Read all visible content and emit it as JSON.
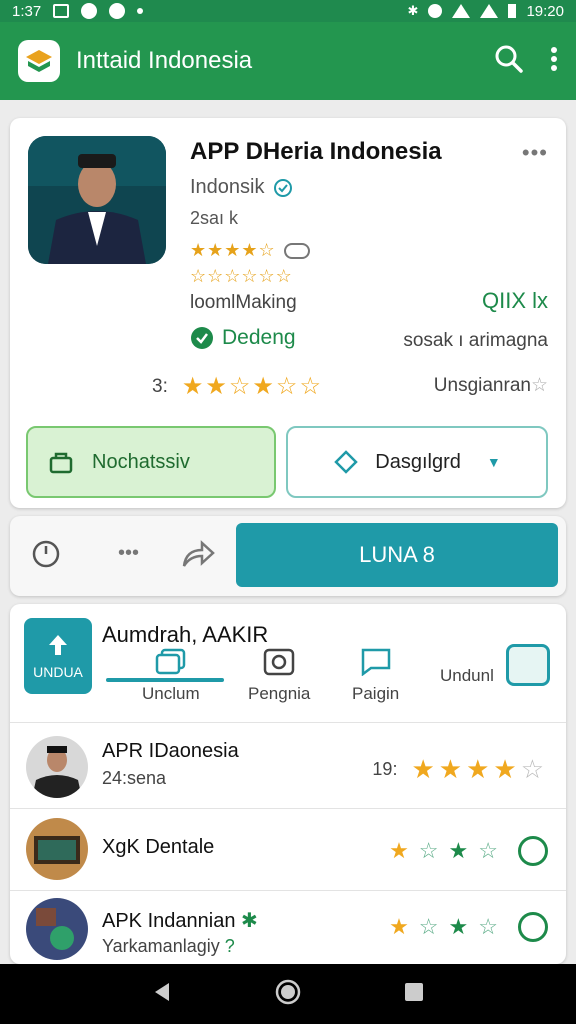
{
  "status_bar": {
    "time_left": "1:37",
    "time_right": "19:20"
  },
  "app_bar": {
    "title": "Inttaid Indonesia",
    "search_icon": "search-icon",
    "more_icon": "more-vert-icon",
    "color": "#23964f"
  },
  "app_detail": {
    "name": "APP DHeria Indonesia",
    "developer": "Indonsik",
    "size": "2saı k",
    "category": "loomlMaking",
    "code": "QIIX lx",
    "badge": "Dedeng",
    "right_desc": "sosak ı arimagna",
    "rating_number": "3:",
    "rating_stars": 3.5,
    "rating_label": "Unsgianran",
    "button_left": "Nochatssiv",
    "button_right": "Dasgılgrd"
  },
  "action_bar": {
    "primary_label": "LUNA 8"
  },
  "list_section": {
    "header": "Aumdrah, AAKIR",
    "tile_label": "UNDUA",
    "sub_tabs": [
      {
        "label": "Unclum"
      },
      {
        "label": "Pengnia"
      },
      {
        "label": "Paigin"
      },
      {
        "label": "Undunl"
      }
    ],
    "items": [
      {
        "title": "APR IDaonesia",
        "subtitle": "24:sena",
        "rating": "19:",
        "stars": 4
      },
      {
        "title": "XgK Dentale"
      },
      {
        "title": "APK Indannian",
        "subtitle": "Yarkamanlagiy"
      }
    ]
  },
  "colors": {
    "green": "#23964f",
    "teal": "#1f9aa8",
    "star": "#f0a81f"
  }
}
